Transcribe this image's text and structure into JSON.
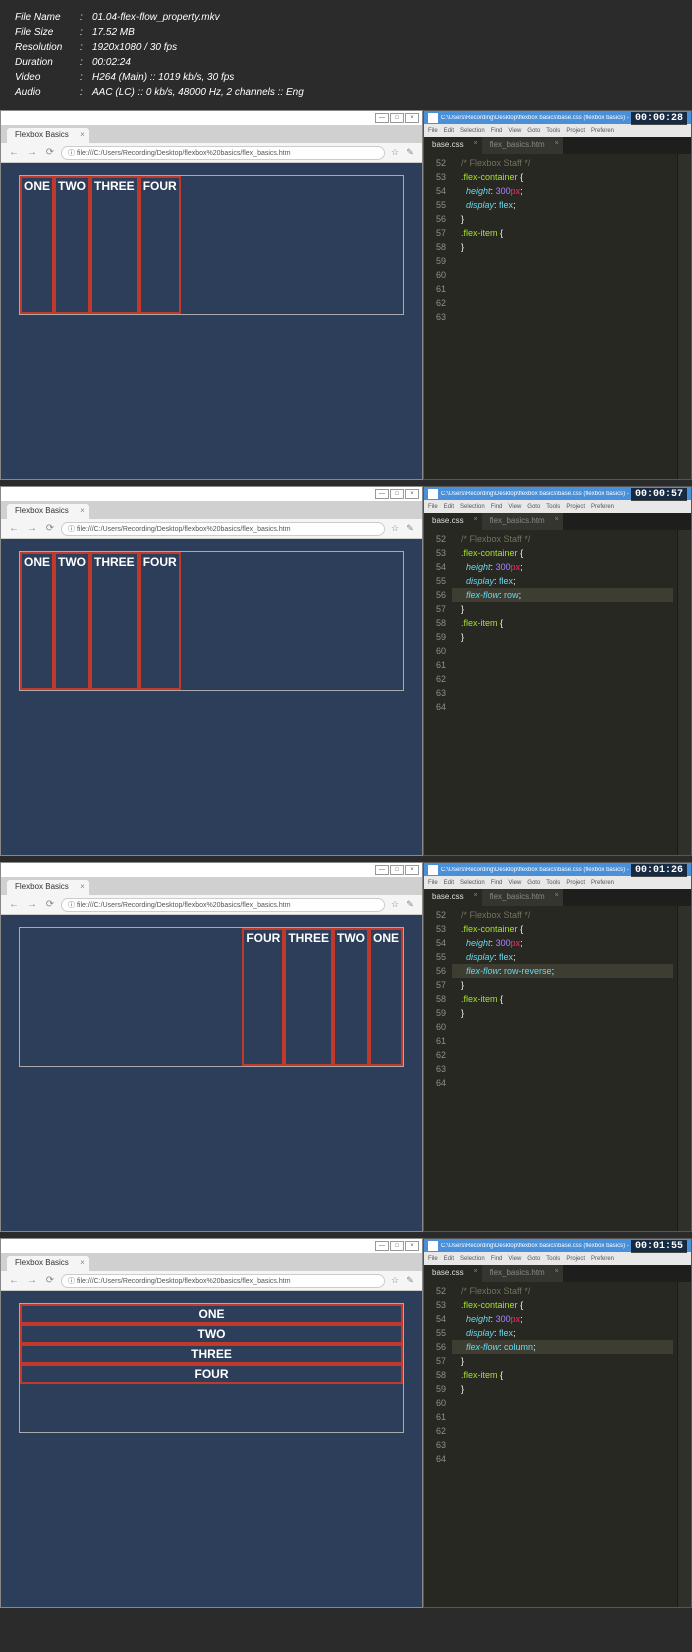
{
  "meta": {
    "fileName": {
      "label": "File Name",
      "value": "01.04-flex-flow_property.mkv"
    },
    "fileSize": {
      "label": "File Size",
      "value": "17.52 MB"
    },
    "resolution": {
      "label": "Resolution",
      "value": "1920x1080 / 30 fps"
    },
    "duration": {
      "label": "Duration",
      "value": "00:02:24"
    },
    "video": {
      "label": "Video",
      "value": "H264 (Main) :: 1019 kb/s, 30 fps"
    },
    "audio": {
      "label": "Audio",
      "value": "AAC (LC) :: 0 kb/s, 48000 Hz, 2 channels :: Eng"
    }
  },
  "browser": {
    "tabTitle": "Flexbox Basics",
    "url": "file:///C:/Users/Recording/Desktop/flexbox%20basics/flex_basics.htm",
    "items": [
      "ONE",
      "TWO",
      "THREE",
      "FOUR"
    ]
  },
  "editor": {
    "titlePath": "C:\\Users\\Recording\\Desktop\\flexbox basics\\base.css (flexbox basics) -",
    "menu": [
      "File",
      "Edit",
      "Selection",
      "Find",
      "View",
      "Goto",
      "Tools",
      "Project",
      "Preferen"
    ],
    "tabs": {
      "active": "base.css",
      "inactive": "flex_basics.htm"
    }
  },
  "panels": [
    {
      "timestamp": "00:00:28",
      "flexMode": "row",
      "lines": [
        {
          "n": "52",
          "t": ""
        },
        {
          "n": "53",
          "t": "comment",
          "v": "  /* Flexbox Staff */"
        },
        {
          "n": "54",
          "t": ""
        },
        {
          "n": "55",
          "t": "sel-open",
          "sel": ".flex-container"
        },
        {
          "n": "56",
          "t": "prop",
          "p": "height",
          "v": "300",
          "u": "px"
        },
        {
          "n": "57",
          "t": "prop-kw",
          "p": "display",
          "v": "flex"
        },
        {
          "n": "58",
          "t": "close"
        },
        {
          "n": "59",
          "t": ""
        },
        {
          "n": "60",
          "t": "sel-open",
          "sel": ".flex-item"
        },
        {
          "n": "61",
          "t": "",
          "hl": true
        },
        {
          "n": "62",
          "t": "close"
        },
        {
          "n": "63",
          "t": ""
        }
      ]
    },
    {
      "timestamp": "00:00:57",
      "flexMode": "row",
      "lines": [
        {
          "n": "52",
          "t": ""
        },
        {
          "n": "53",
          "t": "comment",
          "v": "  /* Flexbox Staff */"
        },
        {
          "n": "54",
          "t": ""
        },
        {
          "n": "55",
          "t": "sel-open",
          "sel": ".flex-container"
        },
        {
          "n": "56",
          "t": "prop",
          "p": "height",
          "v": "300",
          "u": "px"
        },
        {
          "n": "57",
          "t": "prop-kw",
          "p": "display",
          "v": "flex"
        },
        {
          "n": "58",
          "t": "prop-kw",
          "p": "flex-flow",
          "v": "row",
          "hl": true
        },
        {
          "n": "59",
          "t": "close"
        },
        {
          "n": "60",
          "t": ""
        },
        {
          "n": "61",
          "t": "sel-open",
          "sel": ".flex-item"
        },
        {
          "n": "62",
          "t": ""
        },
        {
          "n": "63",
          "t": "close"
        },
        {
          "n": "64",
          "t": ""
        }
      ]
    },
    {
      "timestamp": "00:01:26",
      "flexMode": "row-reverse",
      "lines": [
        {
          "n": "52",
          "t": ""
        },
        {
          "n": "53",
          "t": "comment",
          "v": "  /* Flexbox Staff */"
        },
        {
          "n": "54",
          "t": ""
        },
        {
          "n": "55",
          "t": "sel-open",
          "sel": ".flex-container"
        },
        {
          "n": "56",
          "t": "prop",
          "p": "height",
          "v": "300",
          "u": "px"
        },
        {
          "n": "57",
          "t": "prop-kw",
          "p": "display",
          "v": "flex"
        },
        {
          "n": "58",
          "t": "prop-kw",
          "p": "flex-flow",
          "v": "row-reverse",
          "hl": true
        },
        {
          "n": "59",
          "t": "close"
        },
        {
          "n": "60",
          "t": ""
        },
        {
          "n": "61",
          "t": "sel-open",
          "sel": ".flex-item"
        },
        {
          "n": "62",
          "t": ""
        },
        {
          "n": "63",
          "t": "close"
        },
        {
          "n": "64",
          "t": ""
        }
      ]
    },
    {
      "timestamp": "00:01:55",
      "flexMode": "column",
      "lines": [
        {
          "n": "52",
          "t": ""
        },
        {
          "n": "53",
          "t": "comment",
          "v": "  /* Flexbox Staff */"
        },
        {
          "n": "54",
          "t": ""
        },
        {
          "n": "55",
          "t": "sel-open",
          "sel": ".flex-container"
        },
        {
          "n": "56",
          "t": "prop",
          "p": "height",
          "v": "300",
          "u": "px"
        },
        {
          "n": "57",
          "t": "prop-kw",
          "p": "display",
          "v": "flex"
        },
        {
          "n": "58",
          "t": "prop-kw",
          "p": "flex-flow",
          "v": "column",
          "hl": true
        },
        {
          "n": "59",
          "t": "close"
        },
        {
          "n": "60",
          "t": ""
        },
        {
          "n": "61",
          "t": "sel-open",
          "sel": ".flex-item"
        },
        {
          "n": "62",
          "t": ""
        },
        {
          "n": "63",
          "t": "close"
        },
        {
          "n": "64",
          "t": ""
        }
      ]
    }
  ]
}
